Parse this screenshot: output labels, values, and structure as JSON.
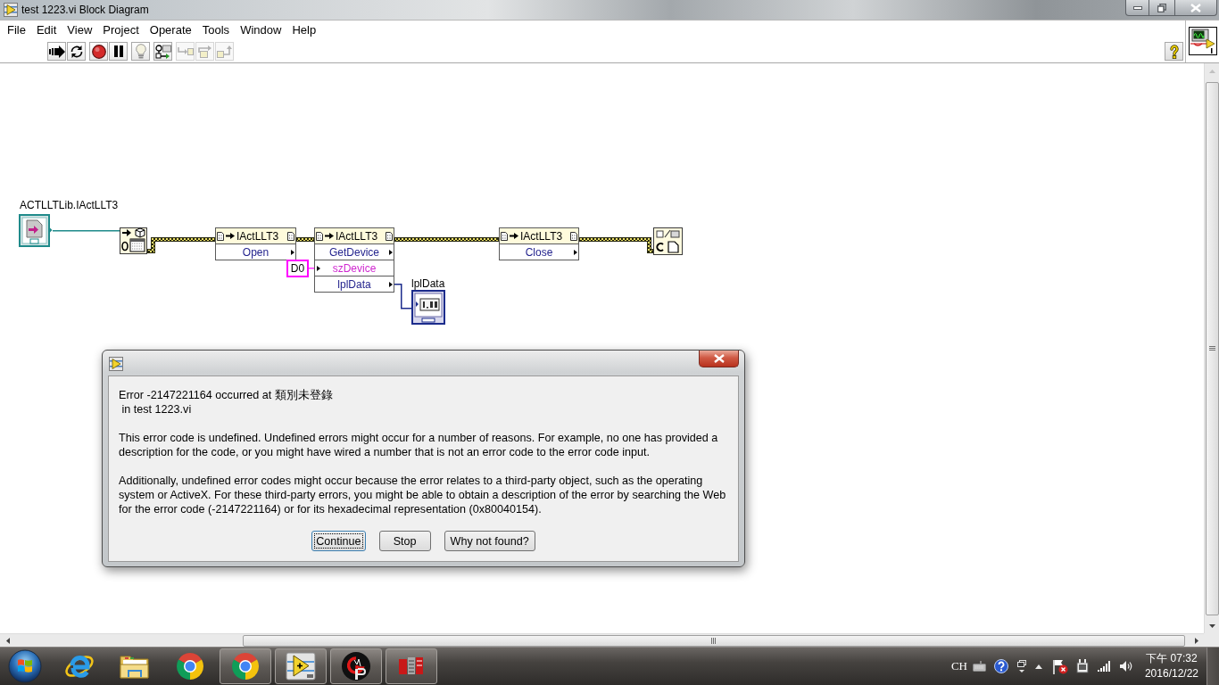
{
  "window": {
    "title": "test 1223.vi Block Diagram"
  },
  "menu": [
    "File",
    "Edit",
    "View",
    "Project",
    "Operate",
    "Tools",
    "Window",
    "Help"
  ],
  "toolbar": [
    {
      "buttons": [
        {
          "kind": "run",
          "disabled": false
        },
        {
          "kind": "run_continuously",
          "disabled": false
        }
      ]
    },
    {
      "buttons": [
        {
          "kind": "abort",
          "disabled": false
        },
        {
          "kind": "pause",
          "disabled": false
        }
      ]
    },
    {
      "buttons": [
        {
          "kind": "highlight_execution",
          "disabled": false
        }
      ]
    },
    {
      "buttons": [
        {
          "kind": "retain_wire_values",
          "disabled": false
        }
      ]
    },
    {
      "buttons": [
        {
          "kind": "step_into",
          "disabled": true
        },
        {
          "kind": "step_over",
          "disabled": true
        },
        {
          "kind": "step_out",
          "disabled": true
        }
      ]
    }
  ],
  "block_diagram": {
    "refnum_constant": {
      "label": "ACTLLTLib.IActLLT3"
    },
    "invoke_nodes": [
      {
        "class": "IActLLT3",
        "terminals": [
          {
            "name": "Open",
            "kind": "output"
          }
        ]
      },
      {
        "class": "IActLLT3",
        "terminals": [
          {
            "name": "GetDevice",
            "kind": "output"
          },
          {
            "name": "szDevice",
            "kind": "string_input"
          },
          {
            "name": "lplData",
            "kind": "output"
          }
        ]
      },
      {
        "class": "IActLLT3",
        "terminals": [
          {
            "name": "Close",
            "kind": "output"
          }
        ]
      }
    ],
    "string_constant": {
      "value": "D0"
    },
    "indicator": {
      "label": "lplData"
    }
  },
  "dialog": {
    "message_lines": [
      "Error -2147221164 occurred at 類別未登錄",
      " in test 1223.vi"
    ],
    "paragraphs": [
      "This error code is undefined. Undefined errors might occur for a number of reasons. For example, no one has provided a description for the code, or you might have wired a number that is not an error code to the error code input.",
      "Additionally, undefined error codes might occur because the error relates to a third-party object, such as the operating system or ActiveX. For these third-party errors, you might be able to obtain a description of the error by searching the Web for the error code (-2147221164) or for its hexadecimal representation (0x80040154)."
    ],
    "buttons": [
      {
        "label": "Continue",
        "focused": true
      },
      {
        "label": "Stop",
        "focused": false
      },
      {
        "label": "Why not found?",
        "focused": false
      }
    ]
  },
  "taskbar": {
    "apps": [
      {
        "kind": "ie",
        "running": false
      },
      {
        "kind": "explorer",
        "running": false
      },
      {
        "kind": "chrome",
        "running": false
      },
      {
        "kind": "chrome",
        "running": true
      },
      {
        "kind": "labview",
        "running": true
      },
      {
        "kind": "gp",
        "running": true
      },
      {
        "kind": "plc",
        "running": true
      }
    ],
    "tray": {
      "language": "CH",
      "time": "下午 07:32",
      "date": "2016/12/22"
    }
  }
}
